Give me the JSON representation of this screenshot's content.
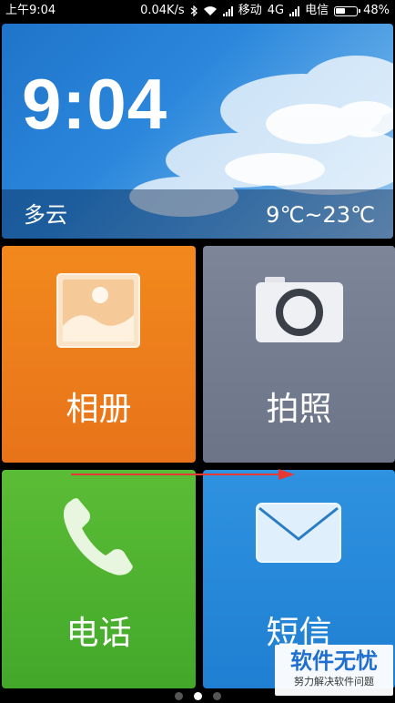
{
  "status_bar": {
    "time": "上午9:04",
    "net_speed": "0.04K/s",
    "carrier1": "移动",
    "network": "4G",
    "carrier2": "电信",
    "battery": "48%",
    "battery_level": 0.48
  },
  "weather": {
    "time": "9:04",
    "condition": "多云",
    "temp_range": "9℃~23℃"
  },
  "tiles": {
    "album": {
      "label": "相册",
      "icon": "photo-icon"
    },
    "camera": {
      "label": "拍照",
      "icon": "camera-icon"
    },
    "phone": {
      "label": "电话",
      "icon": "phone-icon"
    },
    "sms": {
      "label": "短信",
      "icon": "envelope-icon"
    }
  },
  "pager": {
    "count": 3,
    "active": 2
  },
  "watermark": {
    "title": "软件无忧",
    "subtitle": "努力解决软件问题"
  },
  "colors": {
    "album": "#e8731a",
    "camera": "#6c7588",
    "phone": "#43a82a",
    "sms": "#1f7fd2",
    "annotation_arrow": "#e53935"
  }
}
